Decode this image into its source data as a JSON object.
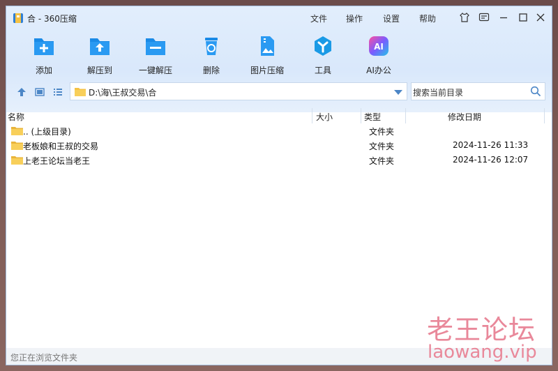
{
  "window": {
    "title": "合 - 360压缩"
  },
  "menu": [
    "文件",
    "操作",
    "设置",
    "帮助"
  ],
  "title_icons": [
    "skin-icon",
    "feedback-icon",
    "minimize-icon",
    "maximize-icon",
    "close-icon"
  ],
  "toolbar": [
    {
      "label": "添加",
      "icon": "add-icon"
    },
    {
      "label": "解压到",
      "icon": "extract-to-icon"
    },
    {
      "label": "一键解压",
      "icon": "one-click-extract-icon"
    },
    {
      "label": "删除",
      "icon": "delete-icon"
    },
    {
      "label": "图片压缩",
      "icon": "image-compress-icon"
    },
    {
      "label": "工具",
      "icon": "tools-icon"
    },
    {
      "label": "AI办公",
      "icon": "ai-office-icon"
    }
  ],
  "address": {
    "path": "D:\\海\\王叔交易\\合"
  },
  "search": {
    "placeholder": "搜索当前目录"
  },
  "columns": {
    "name": "名称",
    "size": "大小",
    "type": "类型",
    "date": "修改日期"
  },
  "rows": [
    {
      "name": ".. (上级目录)",
      "type": "文件夹",
      "date": ""
    },
    {
      "name": "老板娘和王叔的交易",
      "type": "文件夹",
      "date": "2024-11-26 11:33"
    },
    {
      "name": "上老王论坛当老王",
      "type": "文件夹",
      "date": "2024-11-26 12:07"
    }
  ],
  "status": {
    "text": "您正在浏览文件夹"
  },
  "watermark": {
    "line1": "老王论坛",
    "line2": "laowang.vip"
  },
  "colors": {
    "accent": "#1a8ae6",
    "folder": "#f5c244",
    "band": "#dbe9fb"
  }
}
